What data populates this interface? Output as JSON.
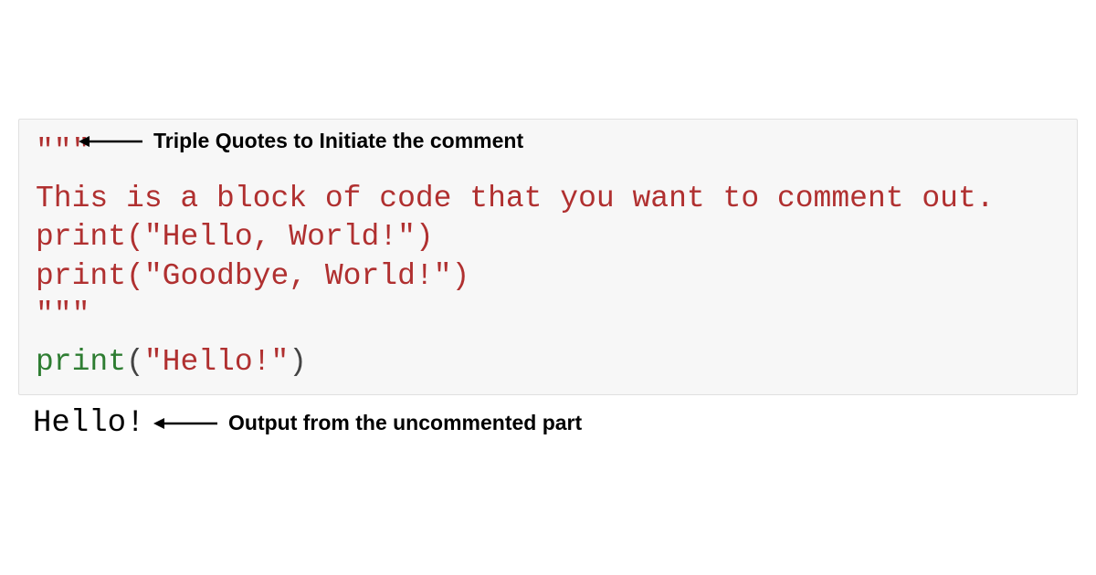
{
  "code": {
    "open_quotes": "\"\"\"",
    "comment_line1": "This is a block of code that you want to comment out.",
    "comment_line2_print": "print",
    "comment_line2_paren_open": "(",
    "comment_line2_arg": "\"Hello, World!\"",
    "comment_line2_paren_close": ")",
    "comment_line3_print": "print",
    "comment_line3_paren_open": "(",
    "comment_line3_arg": "\"Goodbye, World!\"",
    "comment_line3_paren_close": ")",
    "close_quotes": "\"\"\"",
    "exec_print": "print",
    "exec_paren_open": "(",
    "exec_arg": "\"Hello!\"",
    "exec_paren_close": ")"
  },
  "output": "Hello!",
  "annotations": {
    "top": "Triple Quotes to Initiate the comment",
    "bottom": "Output from the uncommented part"
  }
}
